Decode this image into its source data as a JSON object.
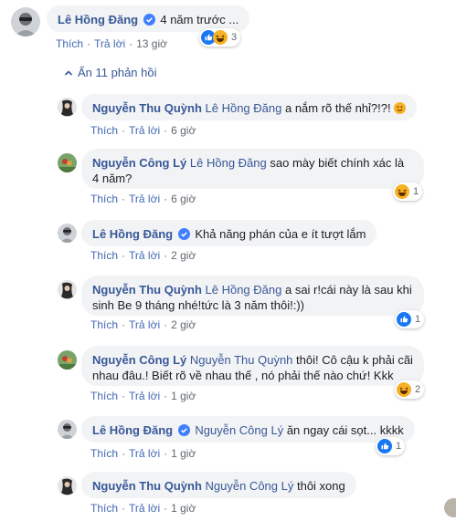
{
  "top_comment": {
    "author": "Lê Hồng Đăng",
    "text": "4 năm trước ...",
    "like_label": "Thích",
    "reply_label": "Trả lời",
    "time": "13 giờ",
    "reaction_count": "3"
  },
  "toggle": {
    "label": "Ẩn 11 phản hồi"
  },
  "replies": [
    {
      "author": "Nguyễn Thu Quỳnh",
      "tag": "Lê Hồng Đăng",
      "text": "a nắm rõ thế nhỉ?!?!",
      "like_label": "Thích",
      "reply_label": "Trả lời",
      "time": "6 giờ"
    },
    {
      "author": "Nguyễn Công Lý",
      "tag": "Lê Hồng Đăng",
      "text": "sao mày biết chính xác là 4 năm?",
      "like_label": "Thích",
      "reply_label": "Trả lời",
      "time": "6 giờ",
      "reaction_count": "1"
    },
    {
      "author": "Lê Hồng Đăng",
      "tag": "",
      "text": "Khả năng phán của e ít tượt lắm",
      "like_label": "Thích",
      "reply_label": "Trả lời",
      "time": "2 giờ"
    },
    {
      "author": "Nguyễn Thu Quỳnh",
      "tag": "Lê Hồng Đăng",
      "text": "a sai r!cái này là sau khi sinh Be 9 tháng nhé!tức là 3 năm thôi!:))",
      "like_label": "Thích",
      "reply_label": "Trả lời",
      "time": "2 giờ",
      "reaction_count": "1"
    },
    {
      "author": "Nguyễn Công Lý",
      "tag": "Nguyễn Thu Quỳnh",
      "text": "thôi! Cô cậu k phải cãi nhau đâu.! Biết rõ về nhau thế , nó phải thế nào chứ! Kkk",
      "like_label": "Thích",
      "reply_label": "Trả lời",
      "time": "1 giờ",
      "reaction_count": "2"
    },
    {
      "author": "Lê Hồng Đăng",
      "tag": "Nguyễn Công Lý",
      "text": "ăn ngay cái sọt... kkkk",
      "like_label": "Thích",
      "reply_label": "Trả lời",
      "time": "1 giờ",
      "reaction_count": "1"
    },
    {
      "author": "Nguyễn Thu Quỳnh",
      "tag": "Nguyễn Công Lý",
      "text": "thôi xong",
      "like_label": "Thích",
      "reply_label": "Trả lời",
      "time": "1 giờ"
    }
  ]
}
